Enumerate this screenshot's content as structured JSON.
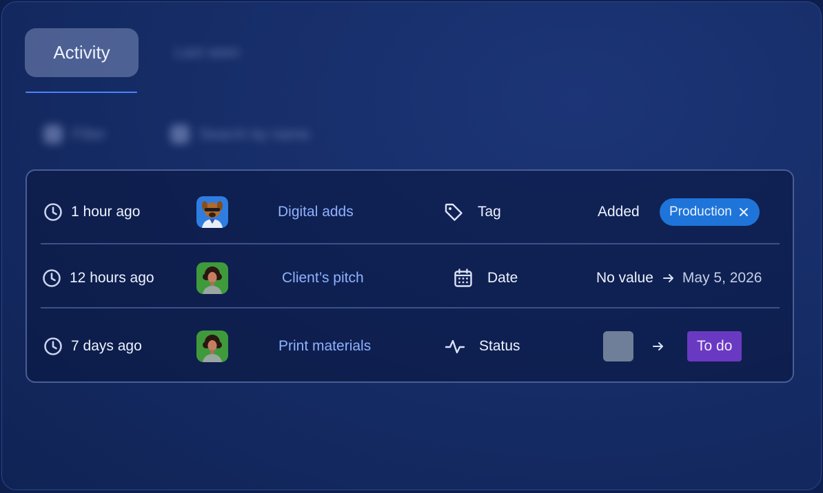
{
  "tabs": {
    "active_label": "Activity",
    "other_label": "Last seen"
  },
  "toolbar": {
    "filter_label": "Filter",
    "search_placeholder": "Search by name"
  },
  "activity": [
    {
      "time": "1 hour ago",
      "avatar": "dog-avatar",
      "item": "Digital adds",
      "field_icon": "tag-icon",
      "field": "Tag",
      "action": "Added",
      "chip": "Production",
      "chip_color": "#1f74d9"
    },
    {
      "time": "12 hours ago",
      "avatar": "person-avatar",
      "item": "Client’s pitch",
      "field_icon": "calendar-icon",
      "field": "Date",
      "from": "No value",
      "to": "May 5, 2026"
    },
    {
      "time": "7 days ago",
      "avatar": "person-avatar",
      "item": "Print materials",
      "field_icon": "activity-icon",
      "field": "Status",
      "from_color": "#6f7f99",
      "to": "To do",
      "to_color": "#6a39c2"
    }
  ],
  "colors": {
    "accent": "#4c82ff",
    "link": "#8fb2ff"
  }
}
